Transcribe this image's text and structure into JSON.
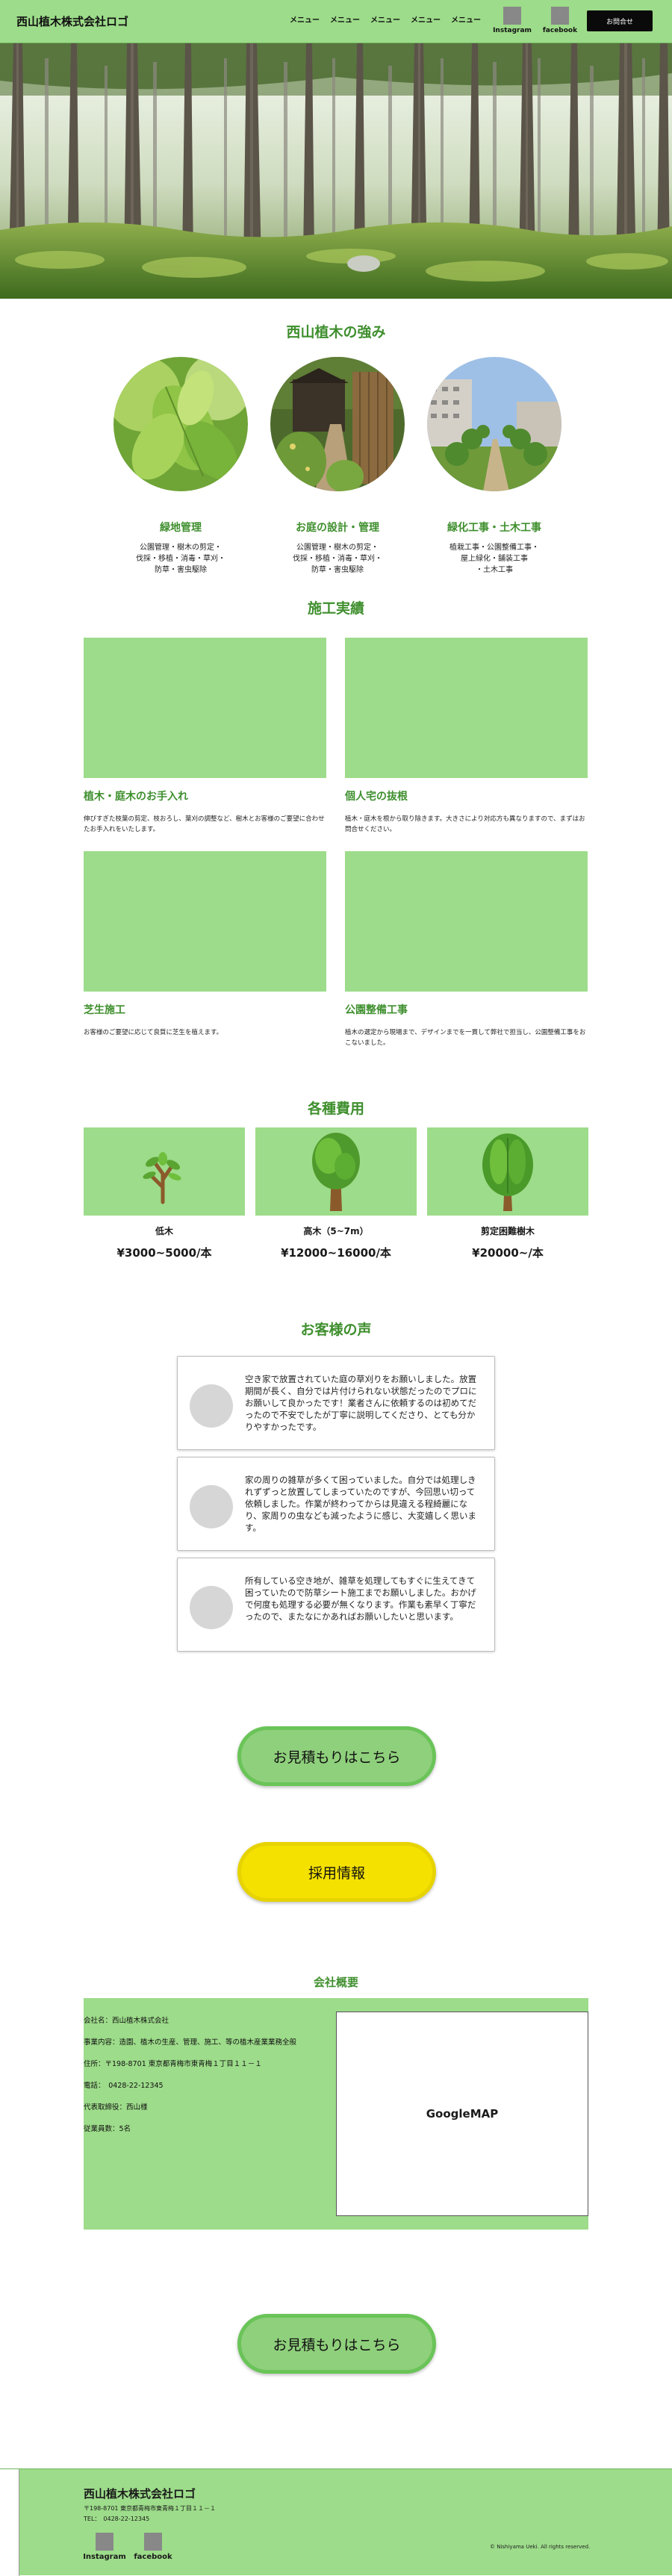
{
  "header": {
    "logo": "西山植木株式会社ロゴ",
    "menu": [
      "メニュー",
      "メニュー",
      "メニュー",
      "メニュー",
      "メニュー"
    ],
    "sns": [
      "Instagram",
      "facebook"
    ],
    "contact_button": "お問合せ"
  },
  "strengths": {
    "title": "西山植木の強み",
    "items": [
      {
        "title": "緑地管理",
        "desc": "公園管理・樹木の剪定・\n伐採・移植・消毒・草刈・\n防草・害虫駆除"
      },
      {
        "title": "お庭の設計・管理",
        "desc": "公園管理・樹木の剪定・\n伐採・移植・消毒・草刈・\n防草・害虫駆除"
      },
      {
        "title": "緑化工事・土木工事",
        "desc": "植栽工事・公園整備工事・\n屋上緑化・舗装工事\n・土木工事"
      }
    ]
  },
  "works": {
    "title": "施工実績",
    "items": [
      {
        "title": "植木・庭木のお手入れ",
        "desc": "伸びすぎた枝葉の剪定、枝おろし、葉刈の調整など、樹木とお客様のご要望に合わせたお手入れをいたします。"
      },
      {
        "title": "個人宅の抜根",
        "desc": "植木・庭木を根から取り除きます。大きさにより対応方も異なりますので、まずはお問合せください。"
      },
      {
        "title": "芝生施工",
        "desc": "お客様のご要望に応じて良質に芝生を植えます。"
      },
      {
        "title": "公園整備工事",
        "desc": "植木の選定から現場まで、デザインまでを一貫して弊社で担当し、公園整備工事をおこないました。"
      }
    ]
  },
  "prices": {
    "title": "各種費用",
    "items": [
      {
        "name": "低木",
        "value": "¥3000~5000/本"
      },
      {
        "name": "高木（5~7m）",
        "value": "¥12000~16000/本"
      },
      {
        "name": "剪定困難樹木",
        "value": "¥20000~/本"
      }
    ]
  },
  "voices": {
    "title": "お客様の声",
    "items": [
      "空き家で放置されていた庭の草刈りをお願いしました。放置期間が長く、自分では片付けられない状態だったのでプロにお願いして良かったです！業者さんに依頼するのは初めてだったので不安でしたが丁寧に説明してくださり、とても分かりやすかったです。",
      "家の周りの雑草が多くて困っていました。自分では処理しきれずずっと放置してしまっていたのですが、今回思い切って依頼しました。作業が終わってからは見違える程綺麗になり、家周りの虫なども減ったように感じ、大変嬉しく思います。",
      "所有している空き地が、雑草を処理してもすぐに生えてきて困っていたので防草シート施工までお願いしました。おかげで何度も処理する必要が無くなります。作業も素早く丁寧だったので、またなにかあればお願いしたいと思います。"
    ]
  },
  "cta": {
    "estimate": "お見積もりはこちら",
    "recruit": "採用情報",
    "estimate_bottom": "お見積もりはこちら"
  },
  "company": {
    "title": "会社概要",
    "rows": [
      "会社名：西山植木株式会社",
      "事業内容：造園、植木の生産、管理、施工、等の植木産業業務全般",
      "住所：〒198-8701 東京都青梅市東青梅１丁目１１－１",
      "電話：　0428-22-12345",
      "代表取締役：西山様",
      "従業員数：5名"
    ],
    "map": "GoogleMAP"
  },
  "footer": {
    "logo": "西山植木株式会社ロゴ",
    "address": "〒198-8701 東京都青梅市東青梅１丁目１１－１",
    "tel": "TEL：　0428-22-12345",
    "sns": [
      "Instagram",
      "facebook"
    ],
    "copyright": "© Nishiyama Ueki. All rights reserved."
  },
  "colors": {
    "primary_green": "#9ddc8a",
    "heading_green": "#3f8f2e",
    "yellow": "#f4e100"
  }
}
